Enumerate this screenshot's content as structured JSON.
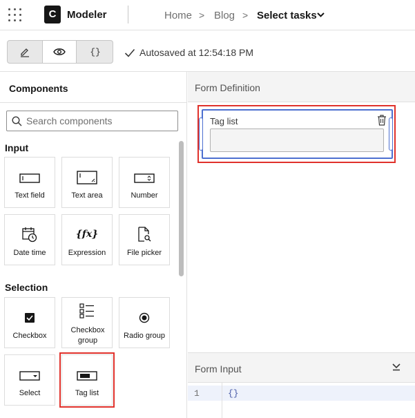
{
  "header": {
    "logo_letter": "C",
    "app_name": "Modeler",
    "breadcrumbs": [
      "Home",
      "Blog",
      "Select tasks"
    ],
    "breadcrumb_separator": ">"
  },
  "toolbar": {
    "modes": [
      {
        "icon": "pencil-icon"
      },
      {
        "icon": "eye-icon"
      },
      {
        "label": "{}"
      }
    ],
    "autosave_text": "Autosaved at 12:54:18 PM"
  },
  "components": {
    "title": "Components",
    "search_placeholder": "Search components",
    "groups": [
      {
        "title": "Input",
        "items": [
          {
            "label": "Text field",
            "icon": "text-field-icon"
          },
          {
            "label": "Text area",
            "icon": "text-area-icon"
          },
          {
            "label": "Number",
            "icon": "number-icon"
          },
          {
            "label": "Date time",
            "icon": "date-time-icon"
          },
          {
            "label": "Expression",
            "icon": "expression-icon"
          },
          {
            "label": "File picker",
            "icon": "file-picker-icon"
          }
        ]
      },
      {
        "title": "Selection",
        "items": [
          {
            "label": "Checkbox",
            "icon": "checkbox-icon"
          },
          {
            "label": "Checkbox group",
            "icon": "checkbox-group-icon"
          },
          {
            "label": "Radio group",
            "icon": "radio-group-icon"
          },
          {
            "label": "Select",
            "icon": "select-icon"
          },
          {
            "label": "Tag list",
            "icon": "tag-list-icon"
          }
        ]
      }
    ],
    "expression_glyph": "{fx}"
  },
  "form_definition": {
    "title": "Form Definition",
    "field": {
      "label": "Tag list"
    }
  },
  "form_input": {
    "title": "Form Input",
    "line_number": "1",
    "code": "{}"
  },
  "colors": {
    "highlight": "#e0312b",
    "selected_field": "#4c6fd0"
  }
}
